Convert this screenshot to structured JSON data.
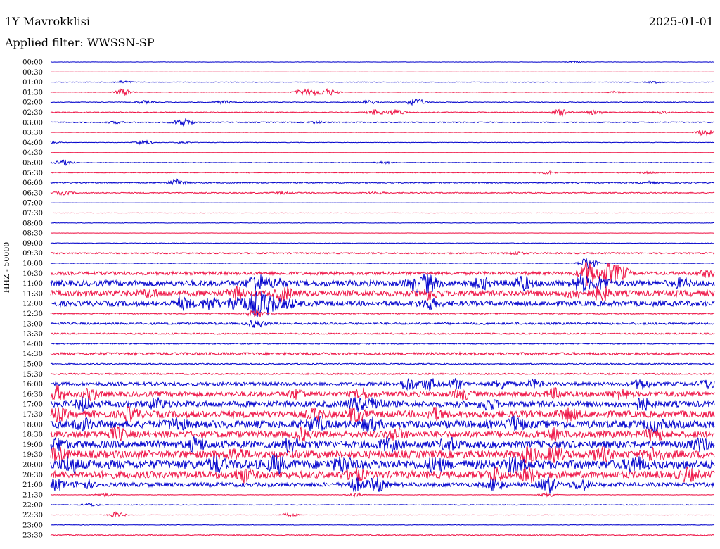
{
  "header": {
    "station": "1Y Mavrokklisi",
    "date": "2025-01-01",
    "filter": "Applied filter: WWSSN-SP"
  },
  "chart_data": {
    "type": "line",
    "subtype": "helicorder",
    "ylabel": "HHZ - 50000",
    "row_colors": [
      "#0000cc",
      "#ee1144"
    ],
    "rows": [
      {
        "time": "00:00",
        "level": 0.05,
        "events": [
          [
            0.79,
            0.3
          ]
        ]
      },
      {
        "time": "00:30",
        "level": 0.03,
        "events": []
      },
      {
        "time": "01:00",
        "level": 0.1,
        "events": [
          [
            0.11,
            0.4
          ],
          [
            0.91,
            0.3
          ]
        ]
      },
      {
        "time": "01:30",
        "level": 0.08,
        "events": [
          [
            0.11,
            1.2
          ],
          [
            0.38,
            0.9
          ],
          [
            0.4,
            0.8
          ],
          [
            0.42,
            1.0
          ],
          [
            0.85,
            0.3
          ]
        ]
      },
      {
        "time": "02:00",
        "level": 0.12,
        "events": [
          [
            0.14,
            0.5
          ],
          [
            0.26,
            0.5
          ],
          [
            0.48,
            0.6
          ],
          [
            0.55,
            1.3
          ]
        ]
      },
      {
        "time": "02:30",
        "level": 0.15,
        "events": [
          [
            0.49,
            0.9
          ],
          [
            0.52,
            1.0
          ],
          [
            0.77,
            1.1
          ],
          [
            0.82,
            0.7
          ],
          [
            0.92,
            0.4
          ]
        ]
      },
      {
        "time": "03:00",
        "level": 0.18,
        "events": [
          [
            0.1,
            0.3
          ],
          [
            0.2,
            1.4
          ],
          [
            0.4,
            0.3
          ]
        ]
      },
      {
        "time": "03:30",
        "level": 0.06,
        "events": [
          [
            0.985,
            1.2
          ]
        ]
      },
      {
        "time": "04:00",
        "level": 0.08,
        "events": [
          [
            0.0,
            0.5
          ],
          [
            0.14,
            0.8
          ],
          [
            0.2,
            0.3
          ]
        ]
      },
      {
        "time": "04:30",
        "level": 0.03,
        "events": []
      },
      {
        "time": "05:00",
        "level": 0.1,
        "events": [
          [
            0.02,
            0.9
          ],
          [
            0.5,
            0.4
          ]
        ]
      },
      {
        "time": "05:30",
        "level": 0.12,
        "events": [
          [
            0.75,
            0.5
          ],
          [
            0.9,
            0.3
          ]
        ]
      },
      {
        "time": "06:00",
        "level": 0.2,
        "events": [
          [
            0.19,
            1.0
          ],
          [
            0.9,
            0.4
          ]
        ]
      },
      {
        "time": "06:30",
        "level": 0.18,
        "events": [
          [
            0.02,
            0.6
          ],
          [
            0.35,
            0.4
          ],
          [
            0.49,
            0.4
          ]
        ]
      },
      {
        "time": "07:00",
        "level": 0.03,
        "events": []
      },
      {
        "time": "07:30",
        "level": 0.05,
        "events": []
      },
      {
        "time": "08:00",
        "level": 0.08,
        "events": []
      },
      {
        "time": "08:30",
        "level": 0.05,
        "events": []
      },
      {
        "time": "09:00",
        "level": 0.1,
        "events": []
      },
      {
        "time": "09:30",
        "level": 0.25,
        "events": [
          [
            0.7,
            0.4
          ]
        ]
      },
      {
        "time": "10:00",
        "level": 0.1,
        "events": [
          [
            0.81,
            2.2
          ]
        ]
      },
      {
        "time": "10:30",
        "level": 0.55,
        "events": [
          [
            0.81,
            4.0
          ],
          [
            0.84,
            3.0
          ],
          [
            0.86,
            2.0
          ],
          [
            0.99,
            1.0
          ]
        ]
      },
      {
        "time": "11:00",
        "level": 1.0,
        "events": [
          [
            0.31,
            2.8
          ],
          [
            0.34,
            1.2
          ],
          [
            0.55,
            2.0
          ],
          [
            0.57,
            2.5
          ],
          [
            0.65,
            1.5
          ],
          [
            0.71,
            2.0
          ],
          [
            0.8,
            2.5
          ],
          [
            0.83,
            1.8
          ],
          [
            0.95,
            1.2
          ]
        ]
      },
      {
        "time": "11:30",
        "level": 1.0,
        "events": [
          [
            0.15,
            1.0
          ],
          [
            0.28,
            1.5
          ],
          [
            0.35,
            2.0
          ],
          [
            0.57,
            1.5
          ],
          [
            0.79,
            1.2
          ],
          [
            0.83,
            2.0
          ]
        ]
      },
      {
        "time": "12:00",
        "level": 0.9,
        "events": [
          [
            0.2,
            1.6
          ],
          [
            0.24,
            1.8
          ],
          [
            0.28,
            2.5
          ],
          [
            0.31,
            3.6
          ],
          [
            0.33,
            3.0
          ],
          [
            0.36,
            1.2
          ],
          [
            0.57,
            1.5
          ]
        ]
      },
      {
        "time": "12:30",
        "level": 0.2,
        "events": [
          [
            0.31,
            1.3
          ]
        ]
      },
      {
        "time": "13:00",
        "level": 0.35,
        "events": [
          [
            0.31,
            1.2
          ]
        ]
      },
      {
        "time": "13:30",
        "level": 0.25,
        "events": []
      },
      {
        "time": "14:00",
        "level": 0.18,
        "events": []
      },
      {
        "time": "14:30",
        "level": 0.45,
        "events": []
      },
      {
        "time": "15:00",
        "level": 0.2,
        "events": []
      },
      {
        "time": "15:30",
        "level": 0.25,
        "events": []
      },
      {
        "time": "16:00",
        "level": 0.6,
        "events": [
          [
            0.54,
            2.0
          ],
          [
            0.57,
            1.8
          ],
          [
            0.61,
            1.5
          ],
          [
            0.68,
            1.4
          ],
          [
            0.73,
            1.2
          ],
          [
            0.89,
            1.4
          ],
          [
            0.99,
            1.2
          ]
        ]
      },
      {
        "time": "16:30",
        "level": 0.85,
        "events": [
          [
            0.01,
            2.2
          ],
          [
            0.06,
            1.6
          ],
          [
            0.37,
            1.4
          ],
          [
            0.47,
            1.5
          ],
          [
            0.62,
            1.5
          ],
          [
            0.76,
            1.4
          ],
          [
            0.86,
            1.5
          ]
        ]
      },
      {
        "time": "17:00",
        "level": 1.0,
        "events": [
          [
            0.05,
            1.8
          ],
          [
            0.16,
            1.5
          ],
          [
            0.46,
            2.0
          ],
          [
            0.49,
            1.8
          ],
          [
            0.66,
            1.5
          ],
          [
            0.89,
            1.8
          ]
        ]
      },
      {
        "time": "17:30",
        "level": 1.15,
        "events": [
          [
            0.01,
            1.8
          ],
          [
            0.12,
            1.8
          ],
          [
            0.4,
            1.6
          ],
          [
            0.46,
            2.0
          ],
          [
            0.58,
            1.5
          ],
          [
            0.78,
            1.8
          ]
        ]
      },
      {
        "time": "18:00",
        "level": 1.25,
        "events": [
          [
            0.05,
            1.6
          ],
          [
            0.19,
            1.8
          ],
          [
            0.4,
            2.0
          ],
          [
            0.48,
            1.8
          ],
          [
            0.7,
            2.0
          ],
          [
            0.91,
            1.8
          ]
        ]
      },
      {
        "time": "18:30",
        "level": 1.1,
        "events": [
          [
            0.1,
            1.8
          ],
          [
            0.38,
            1.5
          ],
          [
            0.52,
            1.6
          ],
          [
            0.76,
            1.5
          ],
          [
            0.91,
            1.8
          ]
        ]
      },
      {
        "time": "19:00",
        "level": 1.25,
        "events": [
          [
            0.01,
            1.6
          ],
          [
            0.22,
            1.8
          ],
          [
            0.36,
            2.0
          ],
          [
            0.51,
            1.8
          ],
          [
            0.6,
            1.6
          ],
          [
            0.98,
            1.5
          ]
        ]
      },
      {
        "time": "19:30",
        "level": 1.3,
        "events": [
          [
            0.01,
            1.8
          ],
          [
            0.28,
            1.6
          ],
          [
            0.72,
            2.2
          ],
          [
            0.76,
            2.0
          ],
          [
            0.83,
            1.8
          ],
          [
            0.91,
            2.0
          ]
        ]
      },
      {
        "time": "20:00",
        "level": 1.5,
        "events": [
          [
            0.03,
            2.2
          ],
          [
            0.25,
            2.0
          ],
          [
            0.34,
            2.4
          ],
          [
            0.44,
            2.0
          ],
          [
            0.58,
            1.8
          ],
          [
            0.7,
            2.0
          ],
          [
            0.88,
            2.2
          ]
        ]
      },
      {
        "time": "20:30",
        "level": 1.2,
        "events": [
          [
            0.29,
            1.8
          ],
          [
            0.46,
            1.6
          ],
          [
            0.67,
            1.8
          ],
          [
            0.72,
            2.0
          ],
          [
            0.96,
            1.6
          ]
        ]
      },
      {
        "time": "21:00",
        "level": 0.7,
        "events": [
          [
            0.01,
            1.6
          ],
          [
            0.05,
            1.2
          ],
          [
            0.46,
            2.0
          ],
          [
            0.49,
            2.2
          ],
          [
            0.67,
            2.0
          ],
          [
            0.75,
            2.6
          ],
          [
            0.8,
            1.8
          ]
        ]
      },
      {
        "time": "21:30",
        "level": 0.08,
        "events": [
          [
            0.08,
            0.6
          ],
          [
            0.46,
            0.6
          ],
          [
            0.75,
            0.7
          ]
        ]
      },
      {
        "time": "22:00",
        "level": 0.12,
        "events": [
          [
            0.06,
            0.5
          ]
        ]
      },
      {
        "time": "22:30",
        "level": 0.05,
        "events": [
          [
            0.1,
            0.9
          ],
          [
            0.36,
            0.6
          ]
        ]
      },
      {
        "time": "23:00",
        "level": 0.08,
        "events": []
      },
      {
        "time": "23:30",
        "level": 0.15,
        "events": []
      }
    ]
  }
}
